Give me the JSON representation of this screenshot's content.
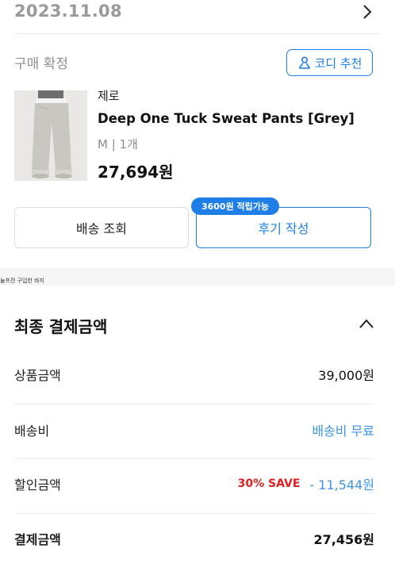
{
  "order": {
    "date": "2023.11.08",
    "status": "구매 확정",
    "codi_button": "코디 추천"
  },
  "product": {
    "brand": "제로",
    "name": "Deep One Tuck Sweat Pants [Grey]",
    "option": "M  |  1개",
    "price": "27,694원"
  },
  "actions": {
    "delivery_label": "배송 조회",
    "review_label": "후기 작성",
    "points_badge": "3600원 적립가능"
  },
  "caption": "눌프전 구입한 바지",
  "payment": {
    "title": "최종 결제금액",
    "rows": [
      {
        "label": "상품금액",
        "value": "39,000원"
      },
      {
        "label": "배송비",
        "value": "배송비 무료"
      },
      {
        "label": "할인금액",
        "save": "30% SAVE",
        "value": "- 11,544원"
      },
      {
        "label": "결제금액",
        "value": "27,456원"
      }
    ]
  },
  "colors": {
    "accent": "#1f7fe6",
    "discount_blue": "#3f95e8",
    "save_red": "#e02020",
    "muted": "#9a9a9a"
  },
  "icons": {
    "chevron_right": "chevron-right-icon",
    "person": "person-icon",
    "chevron_up": "chevron-up-icon"
  }
}
